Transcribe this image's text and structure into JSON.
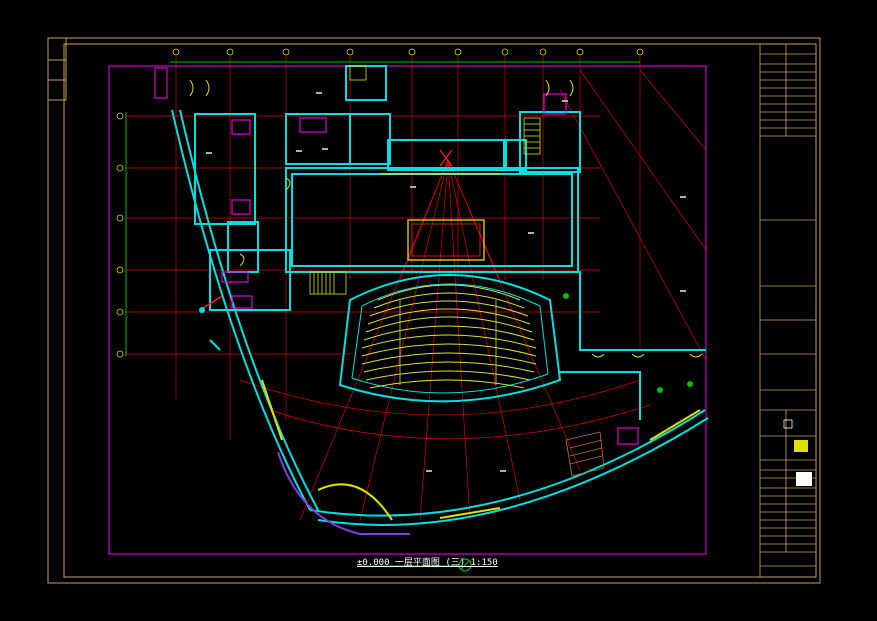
{
  "drawing": {
    "scale_caption": "±0.000 一层平面图 (三) 1:150",
    "colors": {
      "background": "#000000",
      "frame": "#c8a060",
      "viewport": "#d000d0",
      "walls": "#00e0e0",
      "grid": "#e00000",
      "axis": "#00c000",
      "seating": "#d8e040",
      "doors": "#e0e000",
      "stairs": "#e0e000",
      "fixtures": "#e000e0",
      "stage": "#ff2020",
      "labels": "#ffffff"
    },
    "title_block": {
      "rows": 14
    }
  }
}
